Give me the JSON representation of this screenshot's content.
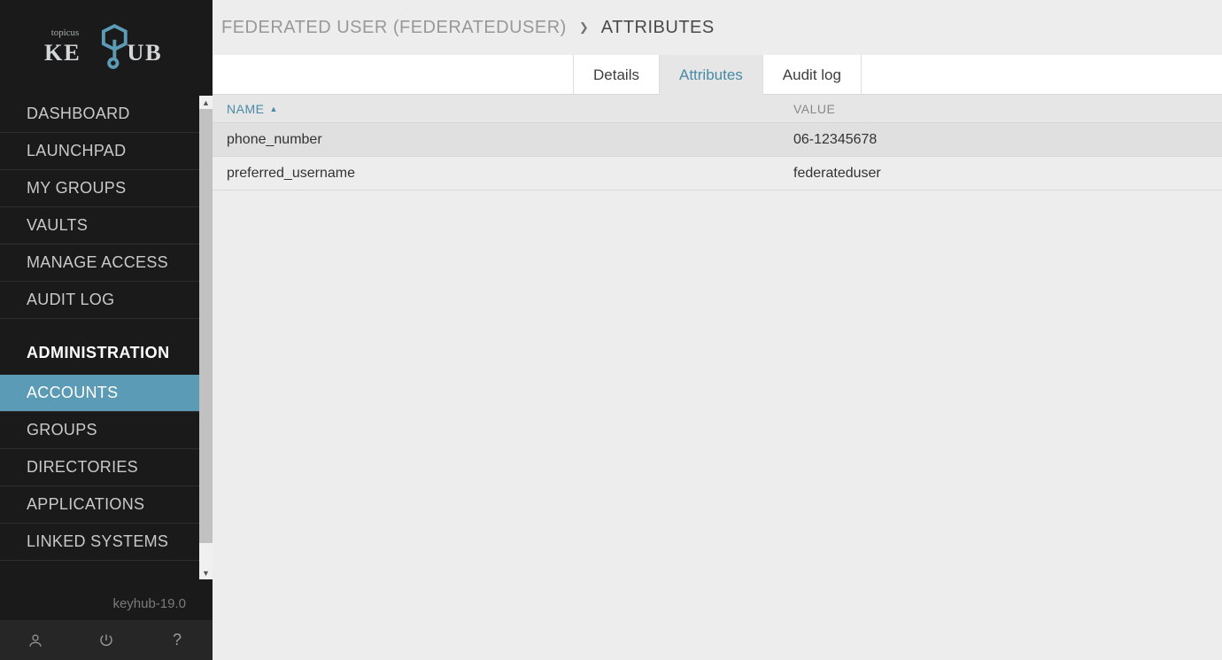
{
  "logo": {
    "brand_top": "topicus",
    "brand_main": "KEYHUB"
  },
  "sidebar": {
    "items_upper": [
      {
        "label": "DASHBOARD",
        "id": "dashboard"
      },
      {
        "label": "LAUNCHPAD",
        "id": "launchpad"
      },
      {
        "label": "MY GROUPS",
        "id": "my-groups"
      },
      {
        "label": "VAULTS",
        "id": "vaults"
      },
      {
        "label": "MANAGE ACCESS",
        "id": "manage-access"
      },
      {
        "label": "AUDIT LOG",
        "id": "audit-log"
      }
    ],
    "section_label": "ADMINISTRATION",
    "items_lower": [
      {
        "label": "ACCOUNTS",
        "id": "accounts",
        "active": true
      },
      {
        "label": "GROUPS",
        "id": "groups"
      },
      {
        "label": "DIRECTORIES",
        "id": "directories"
      },
      {
        "label": "APPLICATIONS",
        "id": "applications"
      },
      {
        "label": "LINKED SYSTEMS",
        "id": "linked-systems"
      }
    ]
  },
  "version": "keyhub-19.0",
  "breadcrumb": {
    "parent": "FEDERATED USER (FEDERATEDUSER)",
    "current": "ATTRIBUTES"
  },
  "tabs": [
    {
      "label": "Details",
      "active": false
    },
    {
      "label": "Attributes",
      "active": true
    },
    {
      "label": "Audit log",
      "active": false
    }
  ],
  "columns": {
    "name": "NAME",
    "value": "VALUE"
  },
  "rows": [
    {
      "name": "phone_number",
      "value": "06-12345678"
    },
    {
      "name": "preferred_username",
      "value": "federateduser"
    }
  ],
  "colors": {
    "accent": "#5b9bb5"
  }
}
